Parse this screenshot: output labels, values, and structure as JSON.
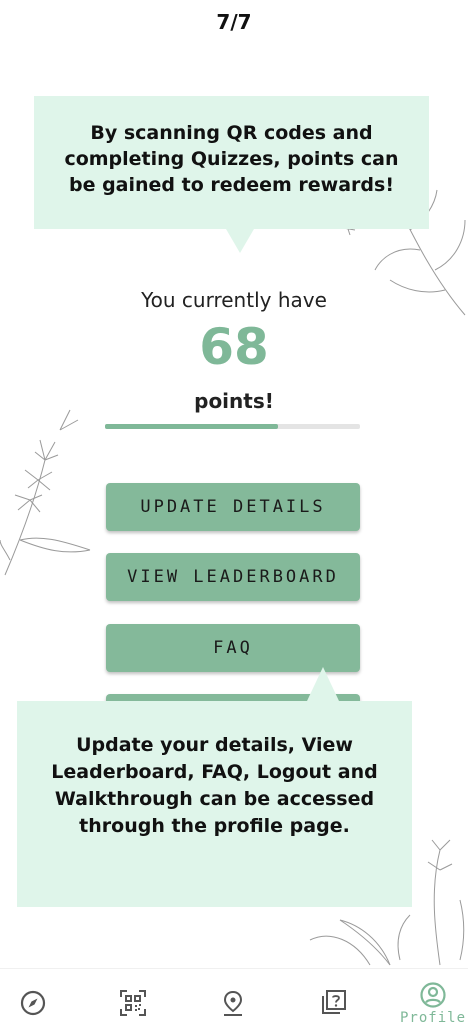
{
  "walkthrough": {
    "step_counter": "7/7",
    "tooltip_points": "By scanning QR codes and completing Quizzes, points can be gained to redeem rewards!",
    "tooltip_profile": "Update your details, View Leaderboard, FAQ, Logout and Walkthrough can be accessed through the profile page."
  },
  "points": {
    "intro": "You currently have",
    "value": "68",
    "suffix": "points!",
    "progress_fraction": 0.68
  },
  "menu": {
    "update_details": "UPDATE DETAILS",
    "view_leaderboard": "VIEW LEADERBOARD",
    "faq": "FAQ"
  },
  "nav": {
    "items": [
      {
        "icon": "compass-icon"
      },
      {
        "icon": "qr-code-icon"
      },
      {
        "icon": "map-pin-icon"
      },
      {
        "icon": "quiz-icon"
      },
      {
        "icon": "profile-icon",
        "label": "Profile",
        "active": true
      }
    ],
    "active_color": "#7fb898",
    "icon_color": "#555555"
  },
  "colors": {
    "accent": "#7fb898",
    "button": "#84b99a",
    "tooltip_bg": "#dff5ea"
  }
}
